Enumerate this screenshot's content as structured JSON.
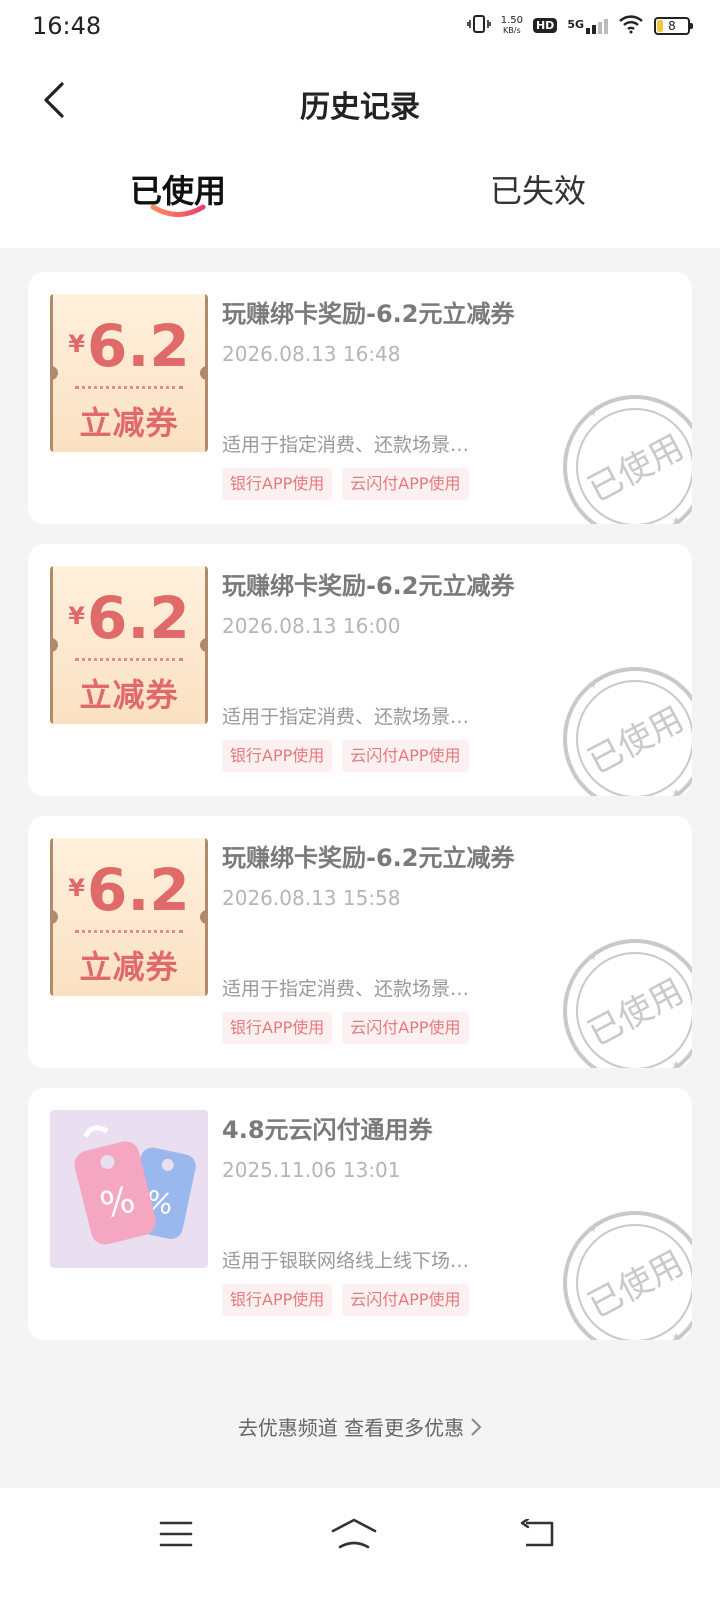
{
  "status": {
    "time": "16:48",
    "net_speed_value": "1.50",
    "net_speed_unit": "KB/s",
    "hd": "HD",
    "signal": "5G",
    "battery": "8"
  },
  "header": {
    "title": "历史记录"
  },
  "tabs": [
    {
      "label": "已使用",
      "active": true
    },
    {
      "label": "已失效",
      "active": false
    }
  ],
  "coupons": [
    {
      "thumb_amount": "6.2",
      "thumb_currency": "¥",
      "thumb_label": "立减券",
      "title": "玩赚绑卡奖励-6.2元立减券",
      "time": "2026.08.13 16:48",
      "desc": "适用于指定消费、还款场景…",
      "tags": [
        "银行APP使用",
        "云闪付APP使用"
      ],
      "stamp": "已使用"
    },
    {
      "thumb_amount": "6.2",
      "thumb_currency": "¥",
      "thumb_label": "立减券",
      "title": "玩赚绑卡奖励-6.2元立减券",
      "time": "2026.08.13 16:00",
      "desc": "适用于指定消费、还款场景…",
      "tags": [
        "银行APP使用",
        "云闪付APP使用"
      ],
      "stamp": "已使用"
    },
    {
      "thumb_amount": "6.2",
      "thumb_currency": "¥",
      "thumb_label": "立减券",
      "title": "玩赚绑卡奖励-6.2元立减券",
      "time": "2026.08.13 15:58",
      "desc": "适用于指定消费、还款场景…",
      "tags": [
        "银行APP使用",
        "云闪付APP使用"
      ],
      "stamp": "已使用"
    },
    {
      "title": "4.8元云闪付通用券",
      "time": "2025.11.06 13:01",
      "desc": "适用于银联网络线上线下场…",
      "tags": [
        "银行APP使用",
        "云闪付APP使用"
      ],
      "stamp": "已使用"
    }
  ],
  "footer": {
    "more_link": "去优惠频道 查看更多优惠"
  },
  "colors": {
    "accent": "#e8506a",
    "coupon_red": "#e06a6a",
    "tag_bg": "#fdf0f0",
    "page_bg": "#f4f4f5"
  }
}
